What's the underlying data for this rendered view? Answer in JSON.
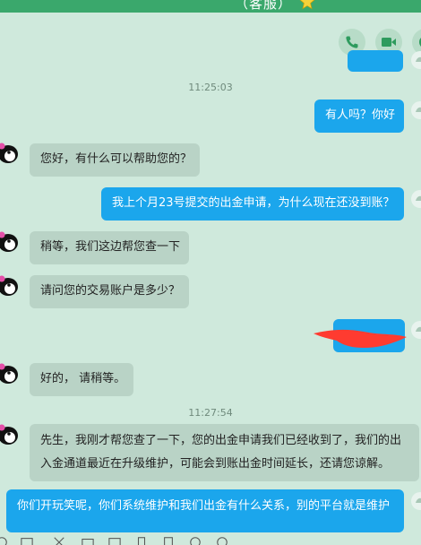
{
  "header": {
    "title": "（客服）"
  },
  "call_buttons": [
    {
      "icon": "phone-icon"
    },
    {
      "icon": "video-icon"
    },
    {
      "icon": "more-icon"
    }
  ],
  "conversation": {
    "top_bubble_partial": "",
    "time_1": "11:25:03",
    "time_2": "11:27:54",
    "messages": [
      {
        "side": "right",
        "text": "有人吗？你好"
      },
      {
        "side": "left",
        "text": "您好，有什么可以帮助您的？"
      },
      {
        "side": "right",
        "text": "我上个月23号提交的出金申请，为什么现在还没到账？"
      },
      {
        "side": "left",
        "text": "稍等，我们这边帮您查一下"
      },
      {
        "side": "left",
        "text": "请问您的交易账户是多少？"
      },
      {
        "side": "right",
        "text": ""
      },
      {
        "side": "left",
        "text": "好的， 请稍等。"
      },
      {
        "side": "left",
        "text": "先生，我刚才帮您查了一下，您的出金申请我们已经收到了，我们的出入金通道最近在升级维护，可能会到账出金时间延长，还请您谅解。"
      },
      {
        "side": "right",
        "text": "你们开玩笑呢，你们系统维护和我们出金有什么关系，别的平台就是维护"
      }
    ]
  },
  "toolbar": {
    "icons": [
      "emoji-icon",
      "gif-icon",
      "scissors-icon",
      "folder-icon",
      "image-icon",
      "shake-icon",
      "red-packet-icon",
      "voice-icon",
      "more-options-icon"
    ]
  }
}
